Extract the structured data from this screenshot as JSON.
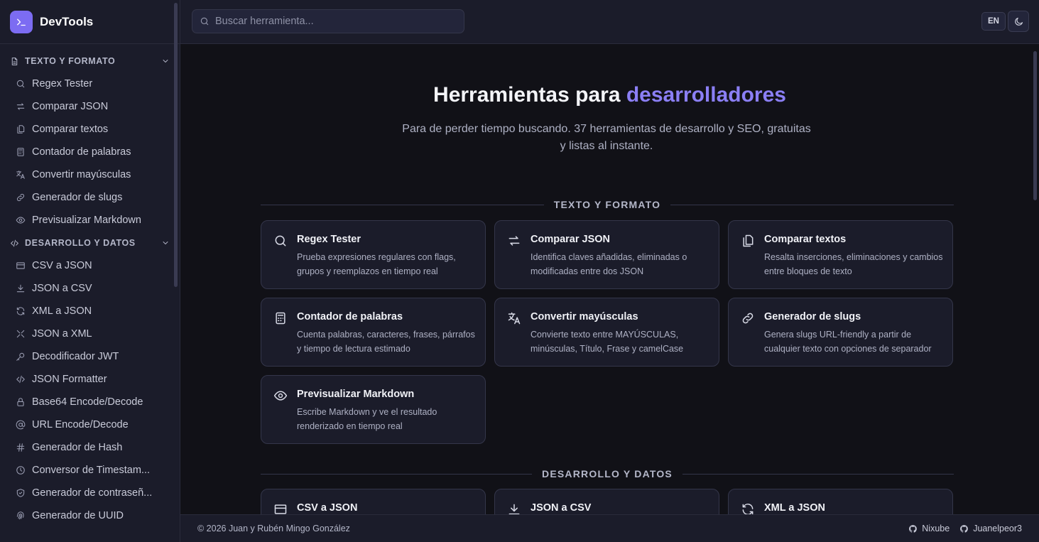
{
  "app": {
    "name": "DevTools"
  },
  "search": {
    "placeholder": "Buscar herramienta..."
  },
  "header": {
    "lang_label": "EN"
  },
  "sidebar": {
    "sections": [
      {
        "title": "TEXTO Y FORMATO",
        "items": [
          {
            "label": "Regex Tester",
            "icon": "search-icon"
          },
          {
            "label": "Comparar JSON",
            "icon": "arrows-swap-icon"
          },
          {
            "label": "Comparar textos",
            "icon": "copy-icon"
          },
          {
            "label": "Contador de palabras",
            "icon": "calculator-icon"
          },
          {
            "label": "Convertir mayúsculas",
            "icon": "translate-icon"
          },
          {
            "label": "Generador de slugs",
            "icon": "link-icon"
          },
          {
            "label": "Previsualizar Markdown",
            "icon": "eye-icon"
          }
        ]
      },
      {
        "title": "DESARROLLO Y DATOS",
        "items": [
          {
            "label": "CSV a JSON",
            "icon": "table-icon"
          },
          {
            "label": "JSON a CSV",
            "icon": "download-icon"
          },
          {
            "label": "XML a JSON",
            "icon": "refresh-icon"
          },
          {
            "label": "JSON a XML",
            "icon": "shuffle-icon"
          },
          {
            "label": "Decodificador JWT",
            "icon": "key-icon"
          },
          {
            "label": "JSON Formatter",
            "icon": "code-icon"
          },
          {
            "label": "Base64 Encode/Decode",
            "icon": "lock-icon"
          },
          {
            "label": "URL Encode/Decode",
            "icon": "at-icon"
          },
          {
            "label": "Generador de Hash",
            "icon": "hash-icon"
          },
          {
            "label": "Conversor de Timestam...",
            "icon": "clock-icon"
          },
          {
            "label": "Generador de contraseñ...",
            "icon": "shield-icon"
          },
          {
            "label": "Generador de UUID",
            "icon": "fingerprint-icon"
          }
        ]
      }
    ]
  },
  "hero": {
    "title_prefix": "Herramientas para ",
    "title_accent": "desarrolladores",
    "subtitle": "Para de perder tiempo buscando. 37 herramientas de desarrollo y SEO, gratuitas y listas al instante."
  },
  "groups": [
    {
      "title": "TEXTO Y FORMATO",
      "cards": [
        {
          "title": "Regex Tester",
          "desc": "Prueba expresiones regulares con flags, grupos y reemplazos en tiempo real",
          "icon": "search-icon"
        },
        {
          "title": "Comparar JSON",
          "desc": "Identifica claves añadidas, eliminadas o modificadas entre dos JSON",
          "icon": "arrows-swap-icon"
        },
        {
          "title": "Comparar textos",
          "desc": "Resalta inserciones, eliminaciones y cambios entre bloques de texto",
          "icon": "copy-icon"
        },
        {
          "title": "Contador de palabras",
          "desc": "Cuenta palabras, caracteres, frases, párrafos y tiempo de lectura estimado",
          "icon": "calculator-icon"
        },
        {
          "title": "Convertir mayúsculas",
          "desc": "Convierte texto entre MAYÚSCULAS, minúsculas, Título, Frase y camelCase",
          "icon": "translate-icon"
        },
        {
          "title": "Generador de slugs",
          "desc": "Genera slugs URL-friendly a partir de cualquier texto con opciones de separador",
          "icon": "link-icon"
        },
        {
          "title": "Previsualizar Markdown",
          "desc": "Escribe Markdown y ve el resultado renderizado en tiempo real",
          "icon": "eye-icon"
        }
      ]
    },
    {
      "title": "DESARROLLO Y DATOS",
      "cards": [
        {
          "title": "CSV a JSON",
          "desc": "",
          "icon": "table-icon"
        },
        {
          "title": "JSON a CSV",
          "desc": "",
          "icon": "download-icon"
        },
        {
          "title": "XML a JSON",
          "desc": "",
          "icon": "refresh-icon"
        }
      ]
    }
  ],
  "footer": {
    "copyright": "© 2026 Juan y Rubén Mingo González",
    "links": [
      {
        "label": "Nixube",
        "icon": "github-icon"
      },
      {
        "label": "Juanelpeor3",
        "icon": "github-icon"
      }
    ]
  }
}
